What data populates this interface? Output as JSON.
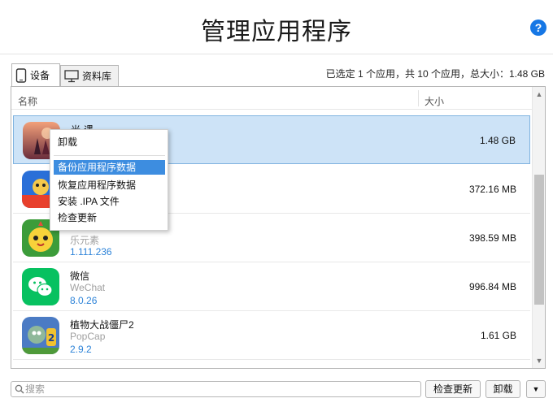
{
  "header": {
    "title": "管理应用程序",
    "help_icon": "?"
  },
  "tabs": [
    {
      "label": "设备",
      "icon": "phone-icon",
      "active": true
    },
    {
      "label": "资料库",
      "icon": "monitor-icon",
      "active": false
    }
  ],
  "status": "已选定 1 个应用，共 10 个应用，总大小：1.48 GB",
  "columns": {
    "name": "名称",
    "size": "大小"
  },
  "apps": [
    {
      "name": "光·遇",
      "vendor": "",
      "version": "",
      "size": "1.48 GB",
      "selected": true,
      "icon": "sky-app-icon"
    },
    {
      "name": "",
      "vendor": "",
      "version": "",
      "size": "372.16 MB",
      "selected": false,
      "icon": "subway-game-app-icon"
    },
    {
      "name": "",
      "vendor": "乐元素",
      "version": "1.111.236",
      "size": "398.59 MB",
      "selected": false,
      "icon": "chick-game-app-icon"
    },
    {
      "name": "微信",
      "vendor": "WeChat",
      "version": "8.0.26",
      "size": "996.84 MB",
      "selected": false,
      "icon": "wechat-app-icon"
    },
    {
      "name": "植物大战僵尸2",
      "vendor": "PopCap",
      "version": "2.9.2",
      "size": "1.61 GB",
      "selected": false,
      "icon": "pvz2-app-icon"
    }
  ],
  "context_menu": {
    "items": [
      "卸载",
      "备份应用程序数据",
      "恢复应用程序数据",
      "安装 .IPA 文件",
      "检查更新"
    ],
    "highlighted": "备份应用程序数据"
  },
  "footer": {
    "search_placeholder": "搜索",
    "check_update_label": "检查更新",
    "uninstall_label": "卸载",
    "more_label": "▼"
  },
  "colors": {
    "accent": "#1677e5",
    "selection": "#cde3f7",
    "version_text": "#2d83d8",
    "menu_highlight": "#3d8de0"
  }
}
